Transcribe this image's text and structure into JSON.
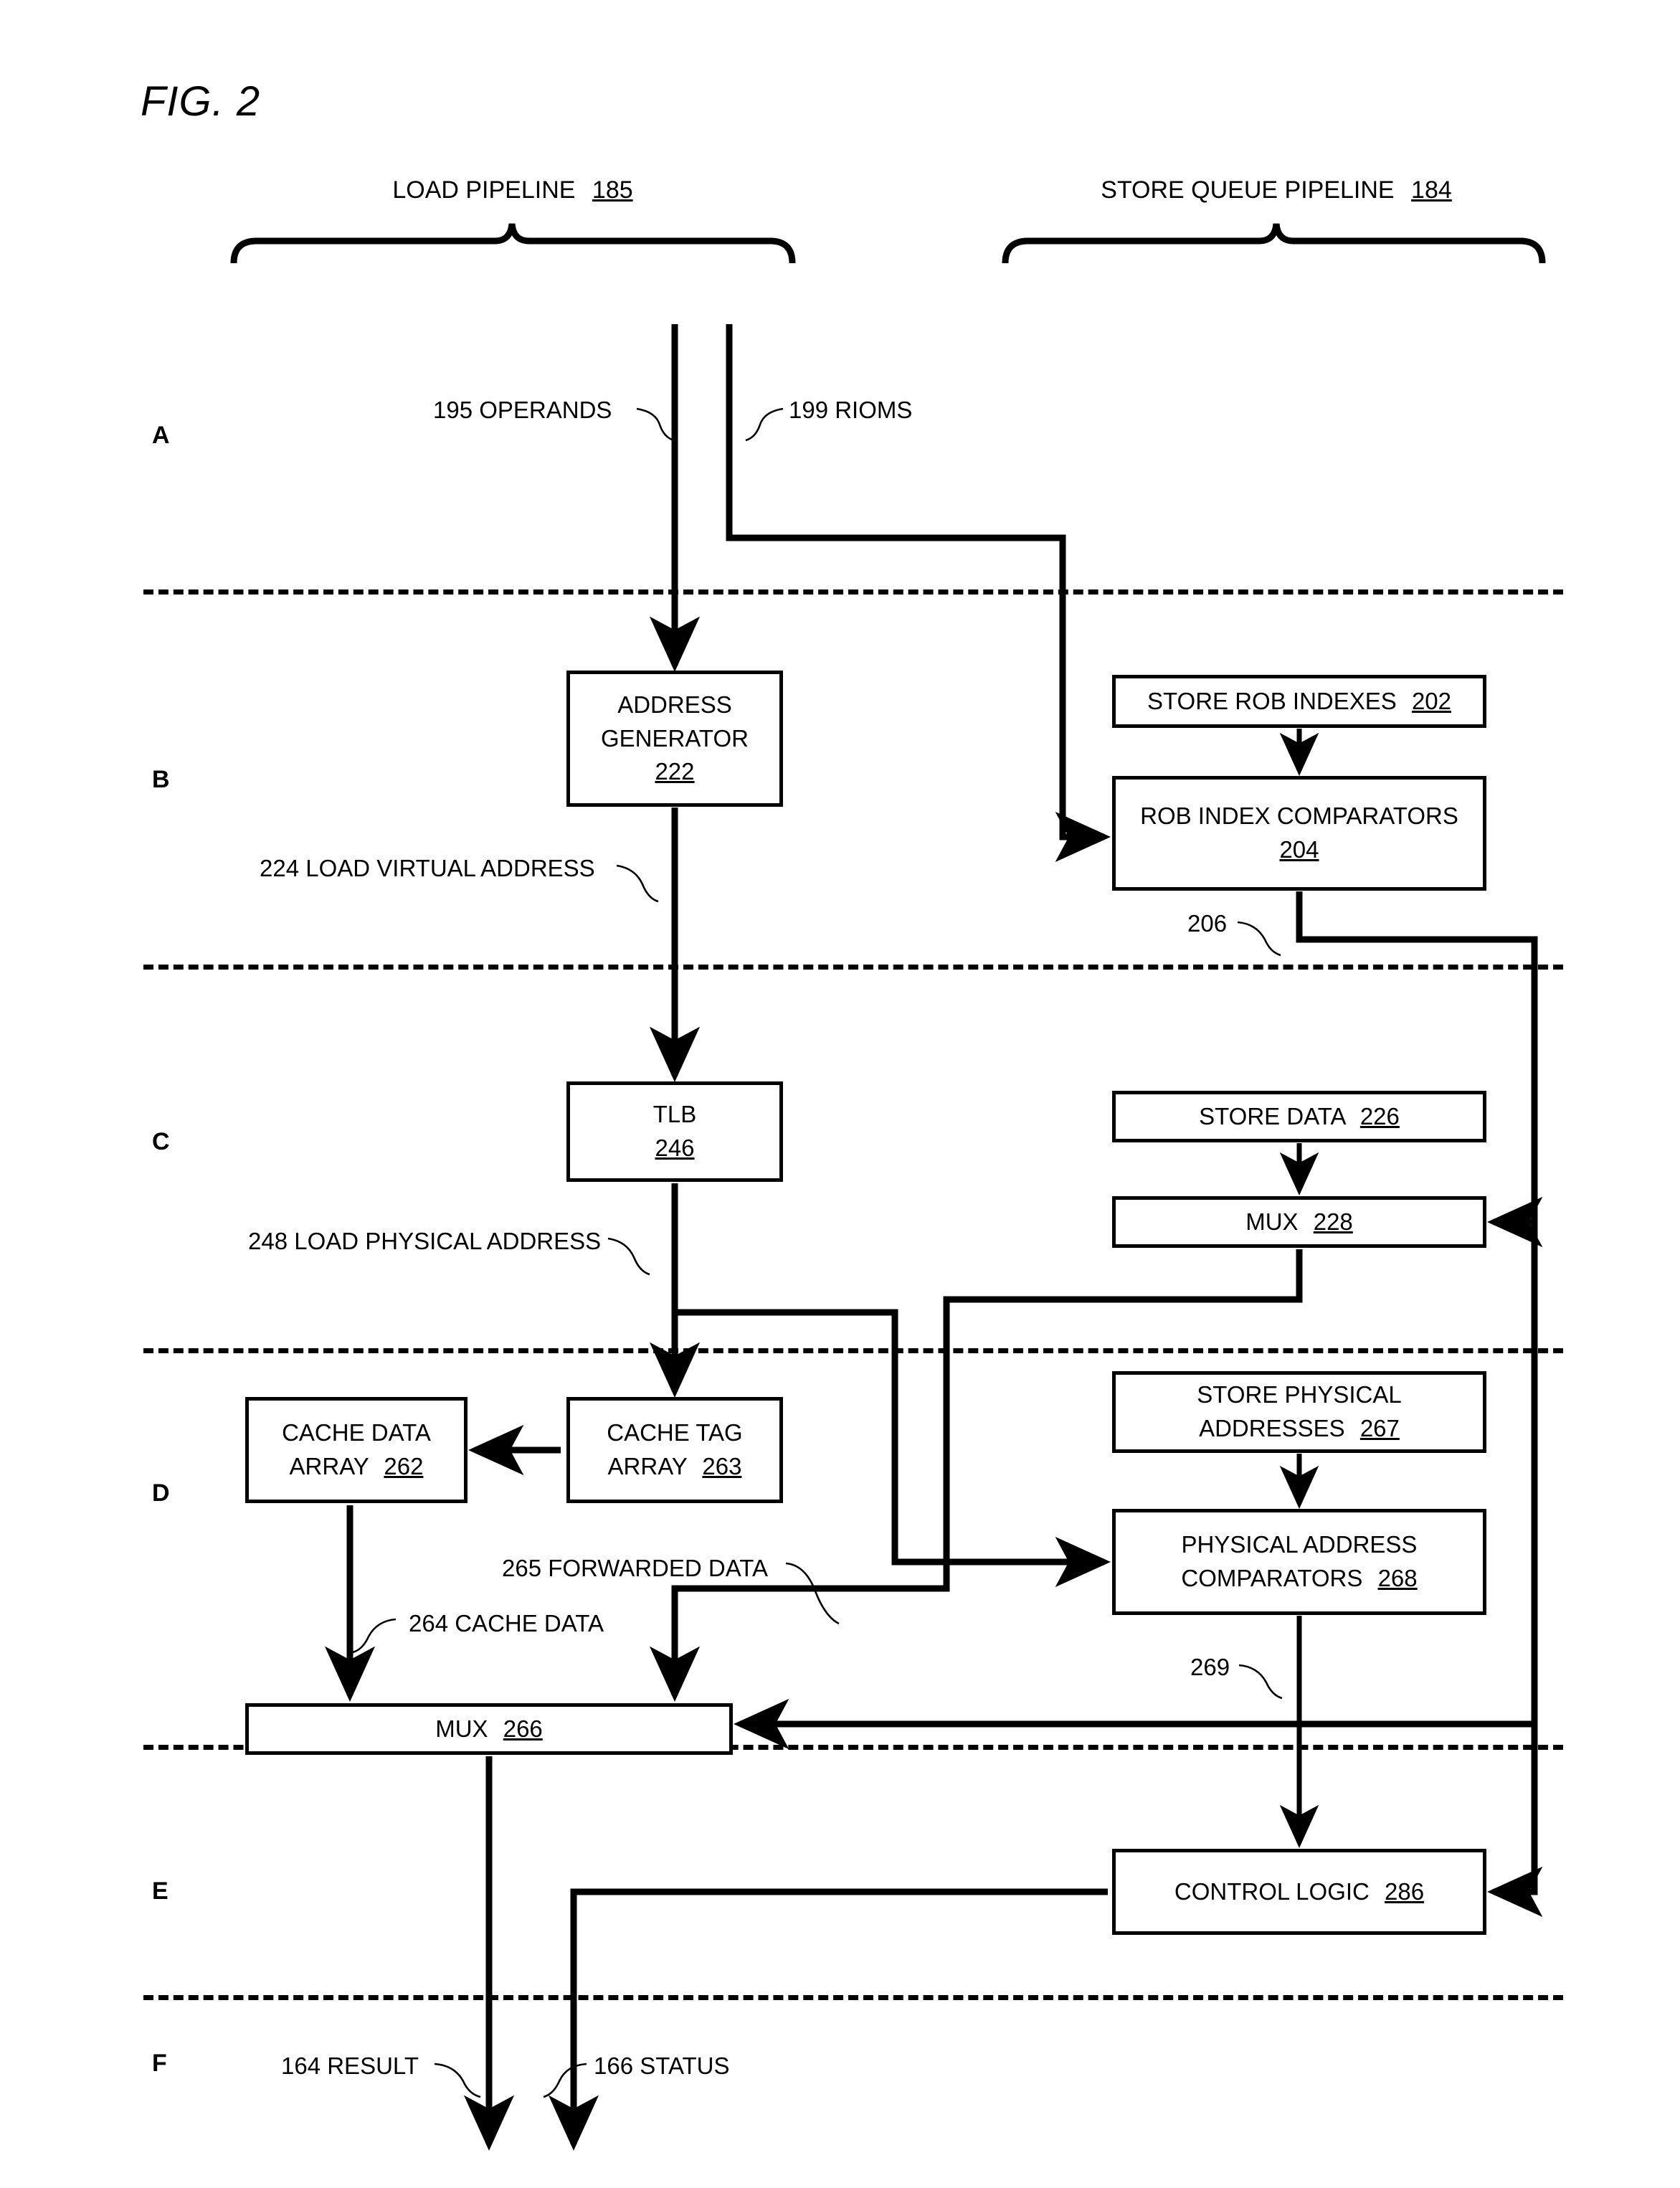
{
  "figure": {
    "title": "FIG. 2"
  },
  "headers": [
    {
      "text": "LOAD PIPELINE",
      "ref": "185"
    },
    {
      "text": "STORE QUEUE PIPELINE",
      "ref": "184"
    }
  ],
  "stages": [
    {
      "label": "A"
    },
    {
      "label": "B"
    },
    {
      "label": "C"
    },
    {
      "label": "D"
    },
    {
      "label": "E"
    },
    {
      "label": "F"
    }
  ],
  "boxes": [
    {
      "id": "address-generator",
      "line1": "ADDRESS",
      "line2": "GENERATOR",
      "ref": "222"
    },
    {
      "id": "store-rob-indexes",
      "line1": "STORE ROB INDEXES",
      "ref": "202"
    },
    {
      "id": "rob-index-comparators",
      "line1": "ROB INDEX COMPARATORS",
      "ref": "204"
    },
    {
      "id": "tlb",
      "line1": "TLB",
      "ref": "246"
    },
    {
      "id": "store-data",
      "line1": "STORE DATA",
      "ref": "226"
    },
    {
      "id": "mux-228",
      "line1": "MUX",
      "ref": "228"
    },
    {
      "id": "cache-data-array",
      "line1": "CACHE DATA",
      "line2": "ARRAY",
      "ref": "262"
    },
    {
      "id": "cache-tag-array",
      "line1": "CACHE TAG",
      "line2": "ARRAY",
      "ref": "263"
    },
    {
      "id": "store-physical-addresses",
      "line1": "STORE PHYSICAL",
      "line2": "ADDRESSES",
      "ref": "267"
    },
    {
      "id": "physical-address-comparators",
      "line1": "PHYSICAL ADDRESS",
      "line2": "COMPARATORS",
      "ref": "268"
    },
    {
      "id": "mux-266",
      "line1": "MUX",
      "ref": "266"
    },
    {
      "id": "control-logic",
      "line1": "CONTROL LOGIC",
      "ref": "286"
    }
  ],
  "signals": [
    {
      "id": "operands",
      "text": "195 OPERANDS"
    },
    {
      "id": "rioms",
      "text": "199 RIOMS"
    },
    {
      "id": "load-virtual-address",
      "text": "224 LOAD VIRTUAL ADDRESS"
    },
    {
      "id": "signal-206",
      "text": "206"
    },
    {
      "id": "load-physical-address",
      "text": "248 LOAD PHYSICAL ADDRESS"
    },
    {
      "id": "forwarded-data",
      "text": "265 FORWARDED DATA"
    },
    {
      "id": "cache-data",
      "text": "264 CACHE DATA"
    },
    {
      "id": "signal-269",
      "text": "269"
    },
    {
      "id": "result",
      "text": "164 RESULT"
    },
    {
      "id": "status",
      "text": "166 STATUS"
    }
  ],
  "colors": {
    "ink": "#000000",
    "paper": "#ffffff"
  }
}
